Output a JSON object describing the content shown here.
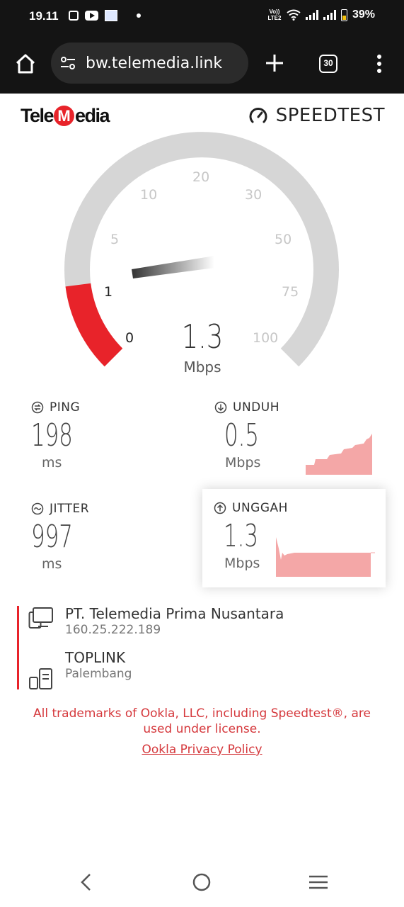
{
  "status_bar": {
    "time": "19.11",
    "network_label": "Vo)) LTE2",
    "battery": "39%",
    "icons": [
      "briefcase-icon",
      "youtube-icon",
      "image-notification-icon",
      "dot-icon",
      "wifi-icon",
      "signal-icon",
      "battery-icon"
    ]
  },
  "browser": {
    "url": "bw.telemedia.link",
    "tab_count": "30",
    "icons": [
      "home-icon",
      "site-settings-icon",
      "new-tab-icon",
      "tabs-icon",
      "menu-icon"
    ]
  },
  "logos": {
    "brand_left_1": "Tele",
    "brand_left_m": "M",
    "brand_left_2": "edia",
    "brand_right": "SPEEDTEST"
  },
  "gauge": {
    "ticks": [
      "0",
      "1",
      "5",
      "10",
      "20",
      "30",
      "50",
      "75",
      "100"
    ],
    "value": "1.3",
    "unit": "Mbps",
    "fill_level": 0.14,
    "colors": {
      "track": "#d6d6d6",
      "fill": "#e8232a",
      "needle": "#333333"
    }
  },
  "metrics": {
    "ping": {
      "label": "PING",
      "value": "198",
      "unit": "ms"
    },
    "download": {
      "label": "UNDUH",
      "value": "0.5",
      "unit": "Mbps",
      "spark_color": "#f4a7a7"
    },
    "jitter": {
      "label": "JITTER",
      "value": "997",
      "unit": "ms"
    },
    "upload": {
      "label": "UNGGAH",
      "value": "1.3",
      "unit": "Mbps",
      "spark_color": "#f4a7a7"
    }
  },
  "server": {
    "isp_name": "PT. Telemedia Prima Nusantara",
    "ip": "160.25.222.189",
    "host": "TOPLINK",
    "location": "Palembang",
    "accent": "#e8232a"
  },
  "footer": {
    "legal": "All trademarks of Ookla, LLC, including Speedtest®, are used under license.",
    "privacy_link": "Ookla Privacy Policy",
    "color": "#d5383c"
  }
}
